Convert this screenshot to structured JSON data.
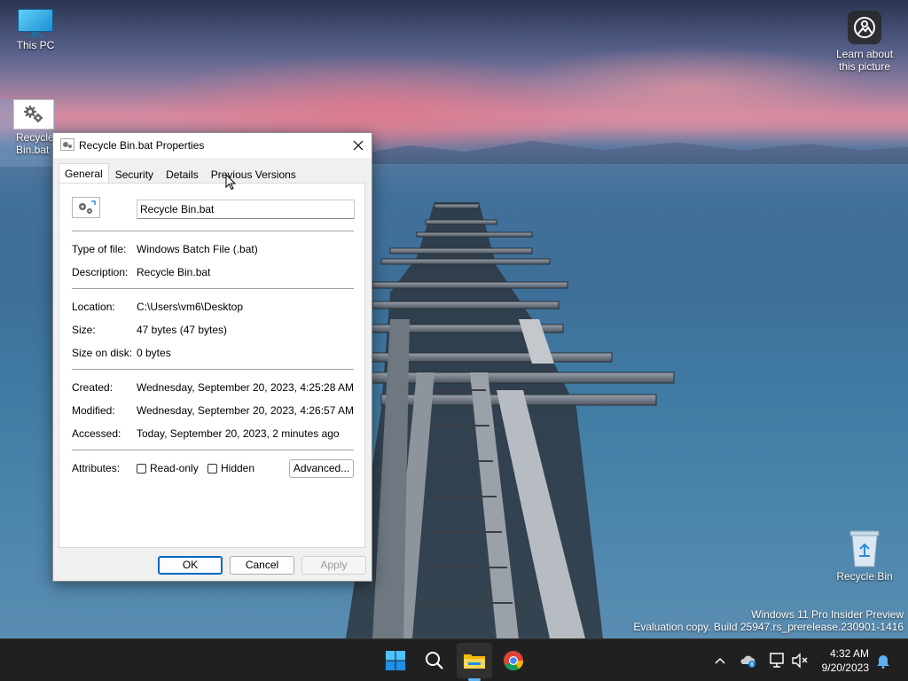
{
  "desktop": {
    "icons": [
      {
        "label": "This PC"
      },
      {
        "label": "Recycle Bin.bat",
        "label_line1": "Recycle",
        "label_line2": "Bin.bat"
      },
      {
        "label": "Learn about this picture",
        "label_line1": "Learn about",
        "label_line2": "this picture"
      },
      {
        "label": "Recycle Bin"
      }
    ]
  },
  "dialog": {
    "title": "Recycle Bin.bat Properties",
    "close_icon": "close-icon",
    "tabs": [
      {
        "label": "General",
        "active": true
      },
      {
        "label": "Security",
        "active": false
      },
      {
        "label": "Details",
        "active": false
      },
      {
        "label": "Previous Versions",
        "active": false
      }
    ],
    "file_name": "Recycle Bin.bat",
    "properties": {
      "type_label": "Type of file:",
      "type_value": "Windows Batch File (.bat)",
      "description_label": "Description:",
      "description_value": "Recycle Bin.bat",
      "location_label": "Location:",
      "location_value": "C:\\Users\\vm6\\Desktop",
      "size_label": "Size:",
      "size_value": "47 bytes (47 bytes)",
      "size_on_disk_label": "Size on disk:",
      "size_on_disk_value": "0 bytes",
      "created_label": "Created:",
      "created_value": "Wednesday, September 20, 2023, 4:25:28 AM",
      "modified_label": "Modified:",
      "modified_value": "Wednesday, September 20, 2023, 4:26:57 AM",
      "accessed_label": "Accessed:",
      "accessed_value": "Today, September 20, 2023, 2 minutes ago",
      "attributes_label": "Attributes:",
      "readonly_label": "Read-only",
      "readonly_checked": false,
      "hidden_label": "Hidden",
      "hidden_checked": false,
      "advanced_label": "Advanced..."
    },
    "buttons": {
      "ok": "OK",
      "cancel": "Cancel",
      "apply": "Apply"
    }
  },
  "watermark": {
    "line1": "Windows 11 Pro Insider Preview",
    "line2": "Evaluation copy. Build 25947.rs_prerelease.230901-1416"
  },
  "taskbar": {
    "apps": [
      "windows-start-icon",
      "search-icon",
      "file-explorer-icon",
      "chrome-icon"
    ],
    "tray": [
      "chevron-up-icon",
      "onedrive-icon",
      "network-icon",
      "volume-muted-icon"
    ],
    "time": "4:32 AM",
    "date": "9/20/2023",
    "notification_icon": "bell-icon"
  },
  "colors": {
    "accent": "#0067c0",
    "taskbar_bg": "#202020",
    "dialog_bg": "#f0f0f0"
  }
}
